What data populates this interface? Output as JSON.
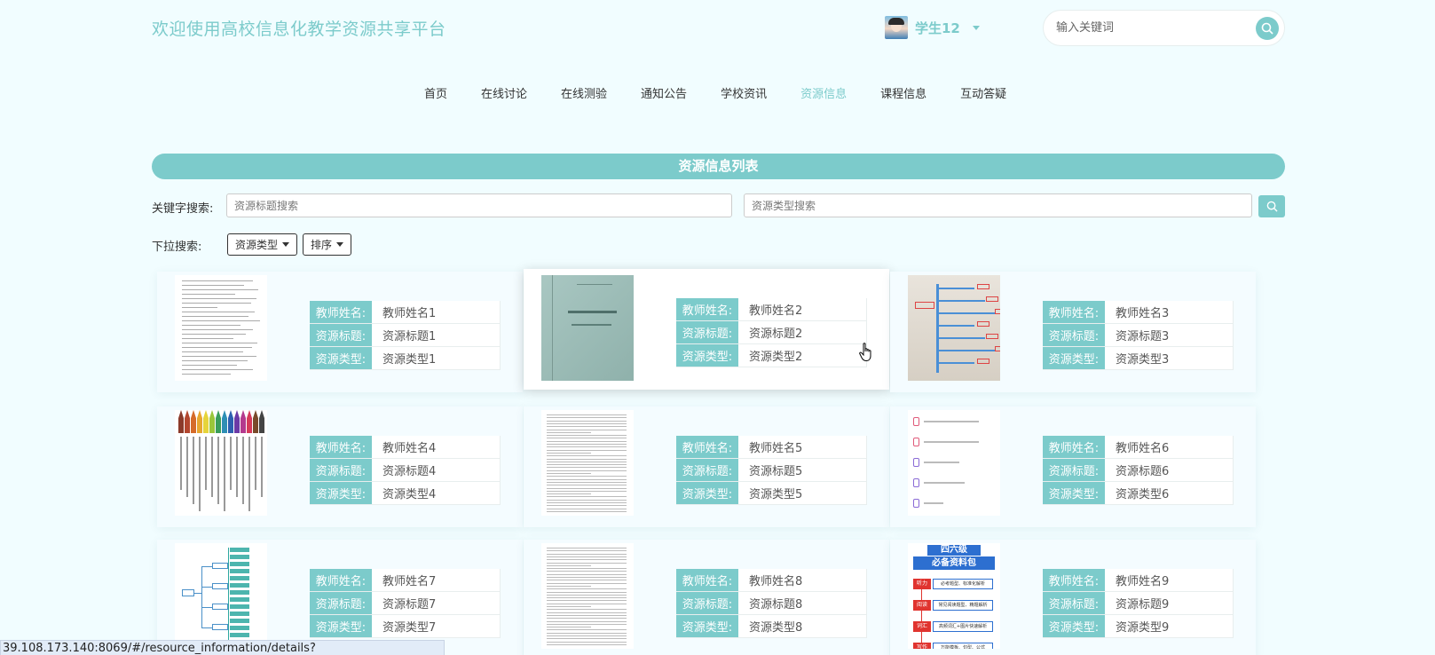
{
  "site": {
    "title": "欢迎使用高校信息化教学资源共享平台"
  },
  "user": {
    "name": "学生12"
  },
  "search": {
    "placeholder": "输入关键词"
  },
  "nav": {
    "items": [
      {
        "label": "首页",
        "active": false
      },
      {
        "label": "在线讨论",
        "active": false
      },
      {
        "label": "在线测验",
        "active": false
      },
      {
        "label": "通知公告",
        "active": false
      },
      {
        "label": "学校资讯",
        "active": false
      },
      {
        "label": "资源信息",
        "active": true
      },
      {
        "label": "课程信息",
        "active": false
      },
      {
        "label": "互动答疑",
        "active": false
      }
    ]
  },
  "list": {
    "title": "资源信息列表"
  },
  "filters": {
    "keyword_label": "关键字搜索:",
    "title_placeholder": "资源标题搜索",
    "type_placeholder": "资源类型搜索",
    "dropdown_label": "下拉搜索:",
    "type_dropdown": "资源类型",
    "sort_dropdown": "排序"
  },
  "field_labels": {
    "teacher": "教师姓名:",
    "title": "资源标题:",
    "type": "资源类型:"
  },
  "cards": [
    {
      "teacher": "教师姓名1",
      "title": "资源标题1",
      "type": "资源类型1",
      "thumb": "document"
    },
    {
      "teacher": "教师姓名2",
      "title": "资源标题2",
      "type": "资源类型2",
      "thumb": "book-cover"
    },
    {
      "teacher": "教师姓名3",
      "title": "资源标题3",
      "type": "资源类型3",
      "thumb": "mindmap-photo"
    },
    {
      "teacher": "教师姓名4",
      "title": "资源标题4",
      "type": "资源类型4",
      "thumb": "color-pencils"
    },
    {
      "teacher": "教师姓名5",
      "title": "资源标题5",
      "type": "资源类型5",
      "thumb": "document-dense"
    },
    {
      "teacher": "教师姓名6",
      "title": "资源标题6",
      "type": "资源类型6",
      "thumb": "file-list"
    },
    {
      "teacher": "教师姓名7",
      "title": "资源标题7",
      "type": "资源类型7",
      "thumb": "mindmap"
    },
    {
      "teacher": "教师姓名8",
      "title": "资源标题8",
      "type": "资源类型8",
      "thumb": "document-dense"
    },
    {
      "teacher": "教师姓名9",
      "title": "资源标题9",
      "type": "资源类型9",
      "thumb": "cet-poster"
    }
  ],
  "thumb_text": {
    "cet_title_1": "四六级",
    "cet_title_2": "必备资料包",
    "cet_rows": [
      {
        "k": "听力",
        "v": "必考题型、标准化解析"
      },
      {
        "k": "阅读",
        "v": "常见阅读题型、精题解析"
      },
      {
        "k": "词汇",
        "v": "高频词汇+图片快速解析"
      },
      {
        "k": "写作",
        "v": "万能模板、句型、公式"
      }
    ]
  },
  "status_bar": {
    "url": "39.108.173.140:8069/#/resource_information/details?resource_information_id=2"
  },
  "colors": {
    "accent": "#7ccbcb",
    "background": "#f1fdff"
  }
}
